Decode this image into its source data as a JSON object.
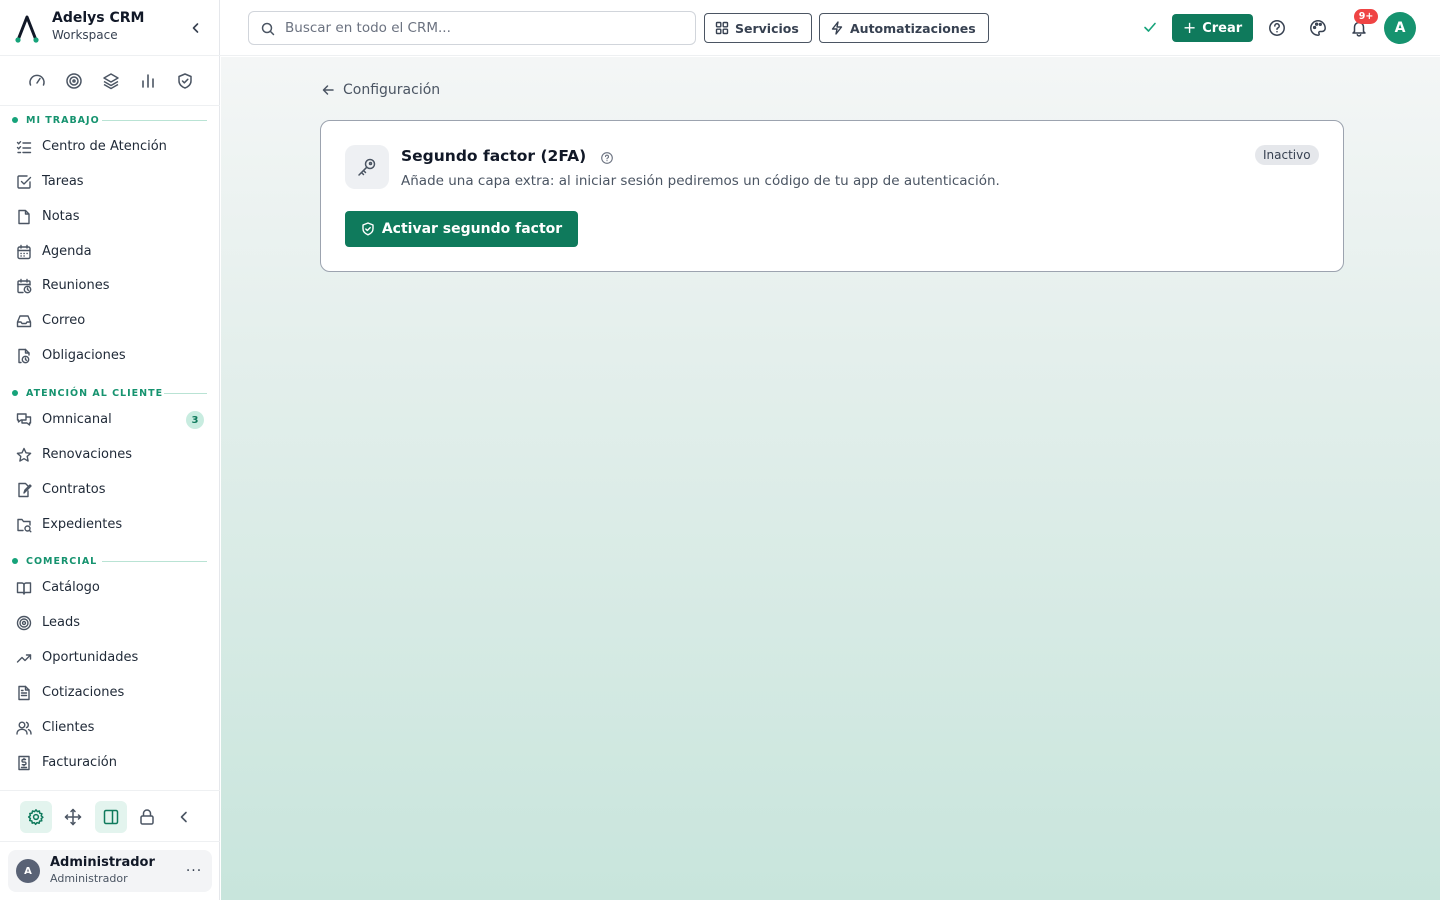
{
  "brand": {
    "name": "Adelys CRM",
    "subtitle": "Workspace"
  },
  "sidebar": {
    "quick_icons": [
      "gauge-icon",
      "target-icon",
      "layers-icon",
      "bar-chart-icon",
      "shield-check-icon"
    ],
    "sections": [
      {
        "label": "MI TRABAJO"
      },
      {
        "label": "ATENCIÓN AL CLIENTE"
      },
      {
        "label": "COMERCIAL"
      }
    ],
    "items": [
      {
        "label": "Centro de Atención",
        "icon": "list-checks-icon"
      },
      {
        "label": "Tareas",
        "icon": "checkbox-icon"
      },
      {
        "label": "Notas",
        "icon": "file-icon"
      },
      {
        "label": "Agenda",
        "icon": "calendar-icon"
      },
      {
        "label": "Reuniones",
        "icon": "calendar-clock-icon"
      },
      {
        "label": "Correo",
        "icon": "inbox-icon"
      },
      {
        "label": "Obligaciones",
        "icon": "file-clock-icon"
      },
      {
        "label": "Omnicanal",
        "icon": "chat-icon",
        "badge": "3"
      },
      {
        "label": "Renovaciones",
        "icon": "star-icon"
      },
      {
        "label": "Contratos",
        "icon": "file-signature-icon"
      },
      {
        "label": "Expedientes",
        "icon": "folder-icon"
      },
      {
        "label": "Catálogo",
        "icon": "book-icon"
      },
      {
        "label": "Leads",
        "icon": "target-icon"
      },
      {
        "label": "Oportunidades",
        "icon": "trending-up-icon"
      },
      {
        "label": "Cotizaciones",
        "icon": "document-icon"
      },
      {
        "label": "Clientes",
        "icon": "users-icon"
      },
      {
        "label": "Facturación",
        "icon": "receipt-icon"
      }
    ],
    "footer_icons": [
      "settings-icon",
      "move-icon",
      "panel-icon",
      "lock-icon",
      "collapse-icon"
    ],
    "user": {
      "initial": "A",
      "name": "Administrador",
      "role": "Administrador",
      "menu": "···"
    }
  },
  "topbar": {
    "search_placeholder": "Buscar en todo el CRM...",
    "services_label": "Servicios",
    "automations_label": "Automatizaciones",
    "create_label": "Crear",
    "create_plus": "+",
    "notifications_badge": "9+",
    "avatar_initial": "A"
  },
  "main": {
    "back_label": "Configuración",
    "card": {
      "title": "Segundo factor (2FA)",
      "description": "Añade una capa extra: al iniciar sesión pediremos un código de tu app de autenticación.",
      "status": "Inactivo",
      "action_label": "Activar segundo factor"
    }
  },
  "colors": {
    "accent": "#0f7a5c",
    "accent_light": "#16a37a",
    "badge_red": "#ef4444"
  }
}
